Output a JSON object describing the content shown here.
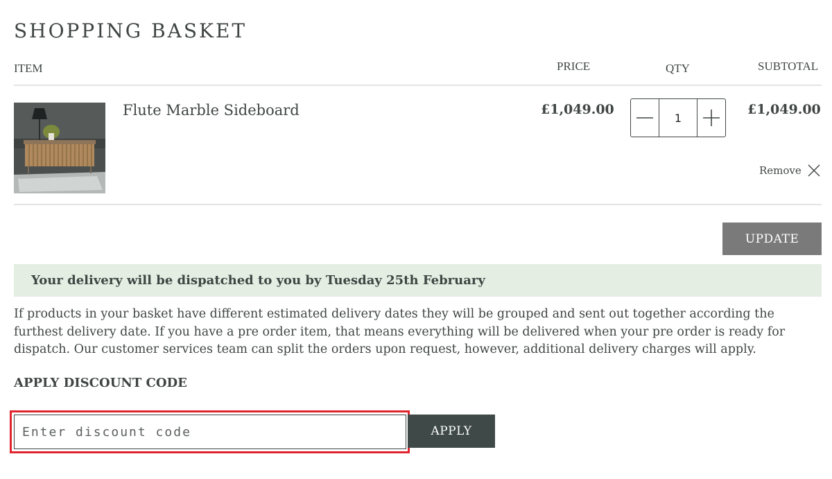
{
  "page": {
    "title": "SHOPPING BASKET"
  },
  "table": {
    "headers": {
      "item": "ITEM",
      "price": "PRICE",
      "qty": "QTY",
      "subtotal": "SUBTOTAL"
    },
    "rows": [
      {
        "name": "Flute Marble Sideboard",
        "price": "£1,049.00",
        "qty": "1",
        "subtotal": "£1,049.00",
        "remove_label": "Remove"
      }
    ]
  },
  "actions": {
    "update_label": "UPDATE"
  },
  "delivery": {
    "banner": "Your delivery will be dispatched to you by Tuesday 25th February",
    "note": "If products in your basket have different estimated delivery dates they will be grouped and sent out together according the furthest delivery date. If you have a pre order item, that means everything will be delivered when your pre order is ready for dispatch. Our customer services team can split the orders upon request, however, additional delivery charges will apply."
  },
  "discount": {
    "heading": "APPLY DISCOUNT CODE",
    "placeholder": "Enter discount code",
    "value": "",
    "apply_label": "APPLY"
  },
  "colors": {
    "text": "#3f4543",
    "banner_bg": "#e4eee3",
    "update_bg": "#7a7a7a",
    "apply_bg": "#3f4a48",
    "highlight": "#e0242e"
  },
  "icons": {
    "qty_minus": "minus-icon",
    "qty_plus": "plus-icon",
    "remove": "close-icon"
  }
}
